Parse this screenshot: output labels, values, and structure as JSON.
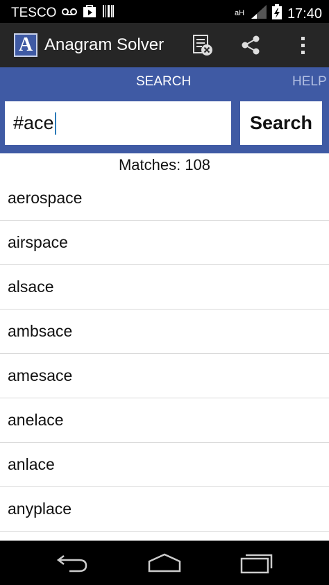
{
  "status_bar": {
    "carrier": "TESCO",
    "time": "17:40",
    "icons": [
      "voicemail-icon",
      "play-store-icon",
      "barcode-icon",
      "nfc-icon",
      "signal-icon",
      "battery-icon"
    ]
  },
  "action_bar": {
    "logo_letter": "A",
    "title": "Anagram Solver",
    "icons": [
      "clear-list-icon",
      "share-icon",
      "overflow-menu-icon"
    ]
  },
  "tabs": [
    {
      "label": "SEARCH",
      "active": true
    },
    {
      "label": "HELP",
      "active": false
    }
  ],
  "search": {
    "value": "#ace",
    "button_label": "Search"
  },
  "results": {
    "matches_text": "Matches: 108",
    "items": [
      "aerospace",
      "airspace",
      "alsace",
      "ambsace",
      "amesace",
      "anelace",
      "anlace",
      "anyplace"
    ]
  },
  "nav_bar": {
    "icons": [
      "back-icon",
      "home-icon",
      "recent-apps-icon"
    ]
  },
  "colors": {
    "primary": "#3f5aa4",
    "action_bar": "#262626",
    "status_bar": "#000000"
  }
}
